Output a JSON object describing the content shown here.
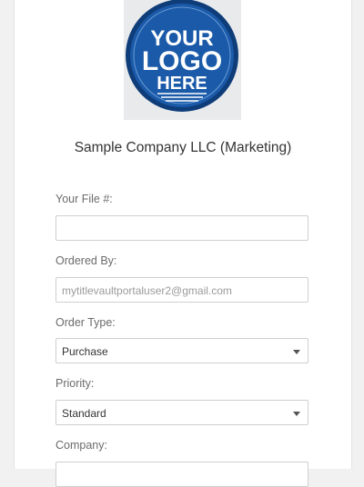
{
  "logo": {
    "line1": "YOUR",
    "line2": "LOGO",
    "line3": "HERE"
  },
  "company_name": "Sample Company LLC (Marketing)",
  "form": {
    "file_label": "Your File #:",
    "file_value": "",
    "ordered_by_label": "Ordered By:",
    "ordered_by_value": "mytitlevaultportaluser2@gmail.com",
    "order_type_label": "Order Type:",
    "order_type_value": "Purchase",
    "priority_label": "Priority:",
    "priority_value": "Standard",
    "company_label": "Company:"
  },
  "colors": {
    "logo_blue": "#1a5aa8",
    "logo_ring": "#0e3d79",
    "page_bg": "#f1f1f1"
  }
}
